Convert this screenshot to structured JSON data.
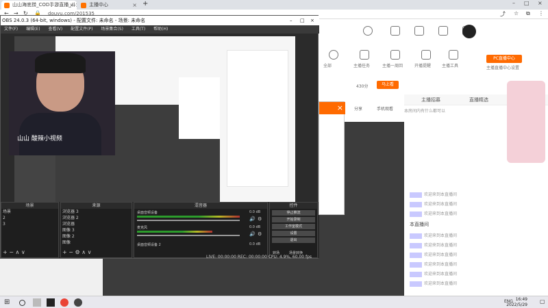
{
  "browser": {
    "tabs": [
      {
        "label": "山山海底捞_COD手游直播_斗鱼"
      },
      {
        "label": "主播中心"
      }
    ],
    "new_tab": "+",
    "url": "douyu.com/201535"
  },
  "site": {
    "header_items": [
      {
        "label": "全部"
      },
      {
        "label": "主播任务"
      },
      {
        "label": "主播一周回"
      },
      {
        "label": "开播提醒"
      },
      {
        "label": "主播工具"
      }
    ],
    "pc_center": "PC直播中心",
    "pc_sub": "主播直播中心设置",
    "count_label": "430分",
    "badge_btn": "马上看",
    "ribbon_tabs": [
      "主播招募",
      "直播精选"
    ],
    "share": "分享",
    "mobile": "手机观看",
    "chat_lines": [
      "本房间内有什么都可以",
      "欢迎来到本直播间",
      "欢迎来到本直播间",
      "欢迎来到本直播间",
      "欢迎来到本直播间",
      "欢迎来到本直播间",
      "欢迎来到本直播间",
      "欢迎来到本直播间",
      "欢迎来到本直播间",
      "欢迎来到本直播间"
    ],
    "chat_section": "本直播间"
  },
  "obs": {
    "title": "OBS 24.0.3 (64-bit, windows) - 配置文件: 未命名 - 场景: 未命名",
    "menu": [
      "文件(F)",
      "编辑(E)",
      "查看(V)",
      "配置文件(P)",
      "场景集合(S)",
      "工具(T)",
      "帮助(H)"
    ],
    "webcam_caption": "山山 酸辣小视频",
    "docks": {
      "scenes": {
        "title": "场景",
        "items": [
          "场景",
          "2",
          "3"
        ]
      },
      "sources": {
        "title": "来源",
        "items": [
          "浏览器 3",
          "浏览器 2",
          "浏览器",
          "图像 3",
          "图像 2",
          "图像"
        ]
      },
      "mixer": {
        "title": "混音器",
        "ch1": "桌面音频设备",
        "ch2": "麦克风",
        "ch3": "桌面音频设备 2",
        "db": "0.0 dB"
      },
      "controls": {
        "title": "控件",
        "buttons": [
          "停止推流",
          "开始录制",
          "工作室模式",
          "设置",
          "退出"
        ],
        "tab1": "转场",
        "tab2": "场景转换"
      }
    },
    "status": "LIVE: 00:00:00   REC: 00:00:00   CPU: 4.9%, 60.00 fps"
  },
  "taskbar": {
    "lang": "ENG",
    "time": "16:49",
    "date": "2022/5/29"
  }
}
